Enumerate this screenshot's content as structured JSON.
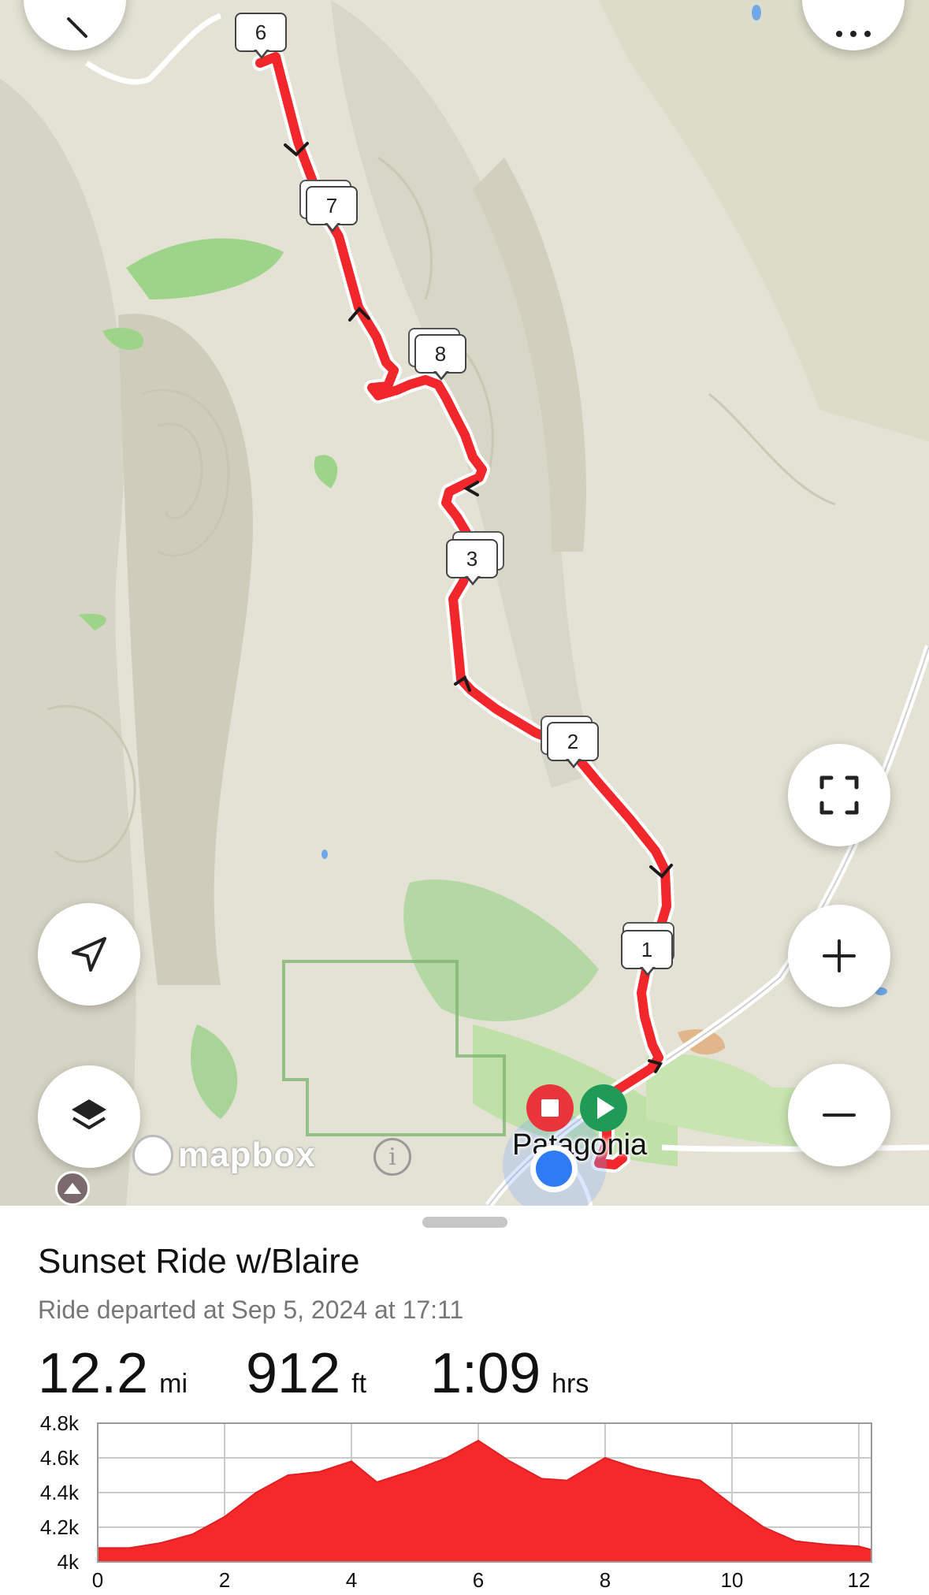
{
  "map": {
    "attribution": "mapbox",
    "town_label": "Patagonia",
    "markers": [
      "6",
      "7",
      "8",
      "3",
      "2",
      "1"
    ]
  },
  "ride": {
    "title": "Sunset Ride w/Blaire",
    "subtitle": "Ride departed at Sep 5, 2024 at 17:11",
    "distance": {
      "value": "12.2",
      "unit": "mi"
    },
    "elevation": {
      "value": "912",
      "unit": "ft"
    },
    "duration": {
      "value": "1:09",
      "unit": "hrs"
    }
  },
  "colors": {
    "route": "#f2272b",
    "start": "#1f9b57",
    "end": "#e9343c",
    "location": "#2f7bf5"
  },
  "icons": [
    "back-icon",
    "more-icon",
    "fullscreen-icon",
    "zoom-in-icon",
    "zoom-out-icon",
    "locate-icon",
    "layers-icon",
    "info-icon",
    "mountain-icon"
  ],
  "chart_data": {
    "type": "area",
    "xlabel": "",
    "ylabel": "",
    "x_ticks": [
      "0",
      "2",
      "4",
      "6",
      "8",
      "10",
      "12"
    ],
    "y_ticks": [
      "4k",
      "4.2k",
      "4.4k",
      "4.6k",
      "4.8k"
    ],
    "xlim": [
      0,
      12.2
    ],
    "ylim": [
      4000,
      4800
    ],
    "grid": true,
    "series": [
      {
        "x": [
          0,
          0.5,
          1,
          1.5,
          2,
          2.5,
          3,
          3.5,
          4,
          4.4,
          5,
          5.5,
          6,
          6.5,
          7,
          7.4,
          8,
          8.5,
          9,
          9.5,
          10,
          10.5,
          11,
          11.5,
          12,
          12.2
        ],
        "y": [
          4080,
          4080,
          4110,
          4160,
          4260,
          4400,
          4500,
          4520,
          4580,
          4460,
          4530,
          4600,
          4700,
          4580,
          4480,
          4470,
          4600,
          4540,
          4500,
          4470,
          4330,
          4200,
          4120,
          4100,
          4090,
          4070
        ]
      }
    ]
  }
}
